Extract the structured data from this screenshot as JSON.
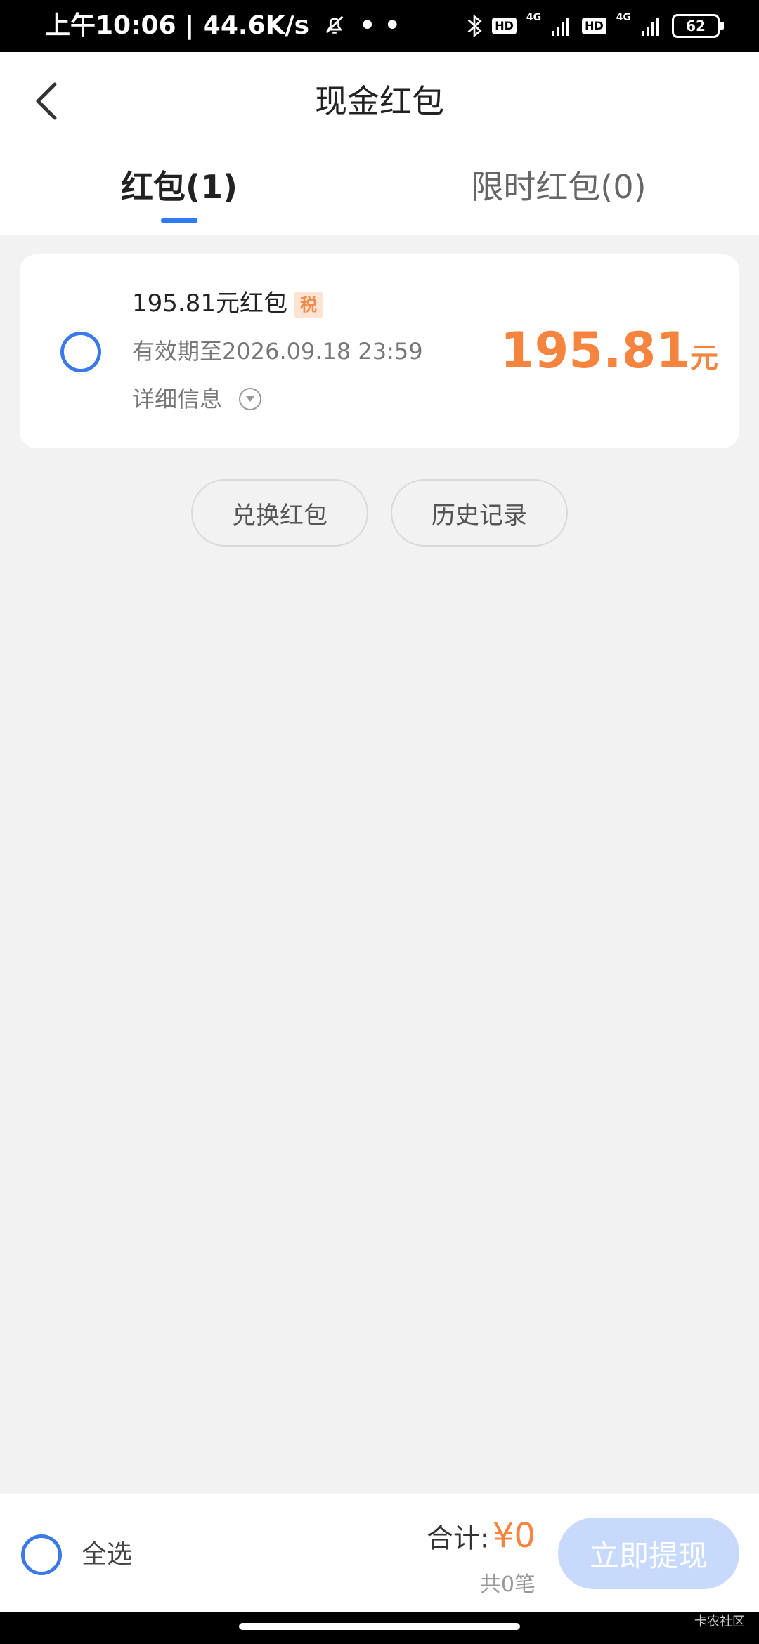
{
  "status_bar": {
    "time_speed": "上午10:06 | 44.6K/s",
    "dots": "• •",
    "hd1": "HD",
    "net1": "4G",
    "hd2": "HD",
    "net2": "4G",
    "battery": "62"
  },
  "header": {
    "title": "现金红包",
    "tabs": [
      {
        "label": "红包(1)",
        "active": true
      },
      {
        "label": "限时红包(0)",
        "active": false
      }
    ]
  },
  "packet": {
    "name": "195.81元红包",
    "tax_badge": "税",
    "expiry": "有效期至2026.09.18 23:59",
    "detail_label": "详细信息",
    "amount": "195.81",
    "unit": "元"
  },
  "actions": {
    "redeem": "兑换红包",
    "history": "历史记录"
  },
  "footer": {
    "select_all": "全选",
    "total_label": "合计:",
    "total_value": "¥0",
    "count": "共0笔",
    "withdraw": "立即提现"
  },
  "watermark": "卡农社区",
  "colors": {
    "accent_blue": "#2f7bf5",
    "amount_orange": "#f5843f",
    "disabled_button": "#c8dafb"
  }
}
